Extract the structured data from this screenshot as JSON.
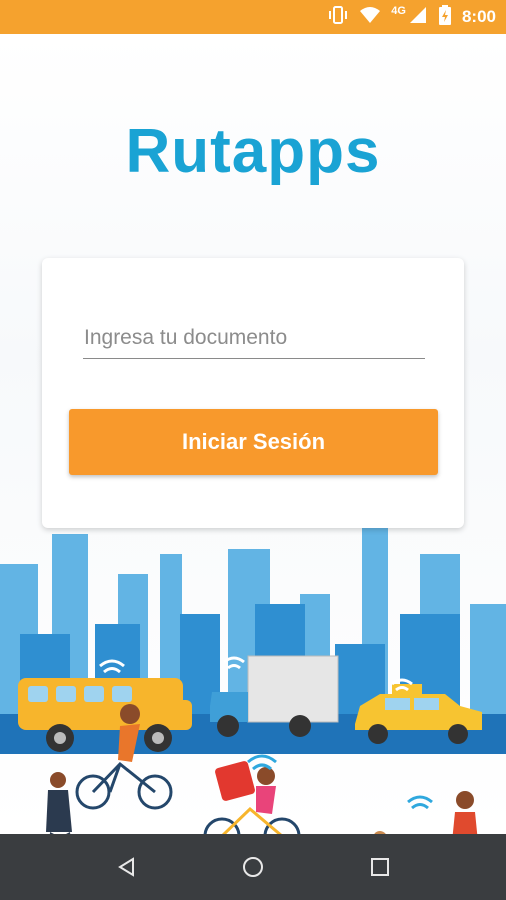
{
  "status_bar": {
    "time": "8:00",
    "network": "4G",
    "icons": [
      "vibrate-icon",
      "wifi-icon",
      "signal-icon",
      "battery-icon"
    ],
    "background": "#f5a22e"
  },
  "app": {
    "logo_text": "Rutapps",
    "logo_color": "#1aa3d4"
  },
  "login": {
    "document_placeholder": "Ingresa tu documento",
    "document_value": "",
    "submit_label": "Iniciar Sesión",
    "button_color": "#f8992c"
  },
  "navigation": {
    "buttons": [
      "back-icon",
      "home-icon",
      "recents-icon"
    ]
  }
}
